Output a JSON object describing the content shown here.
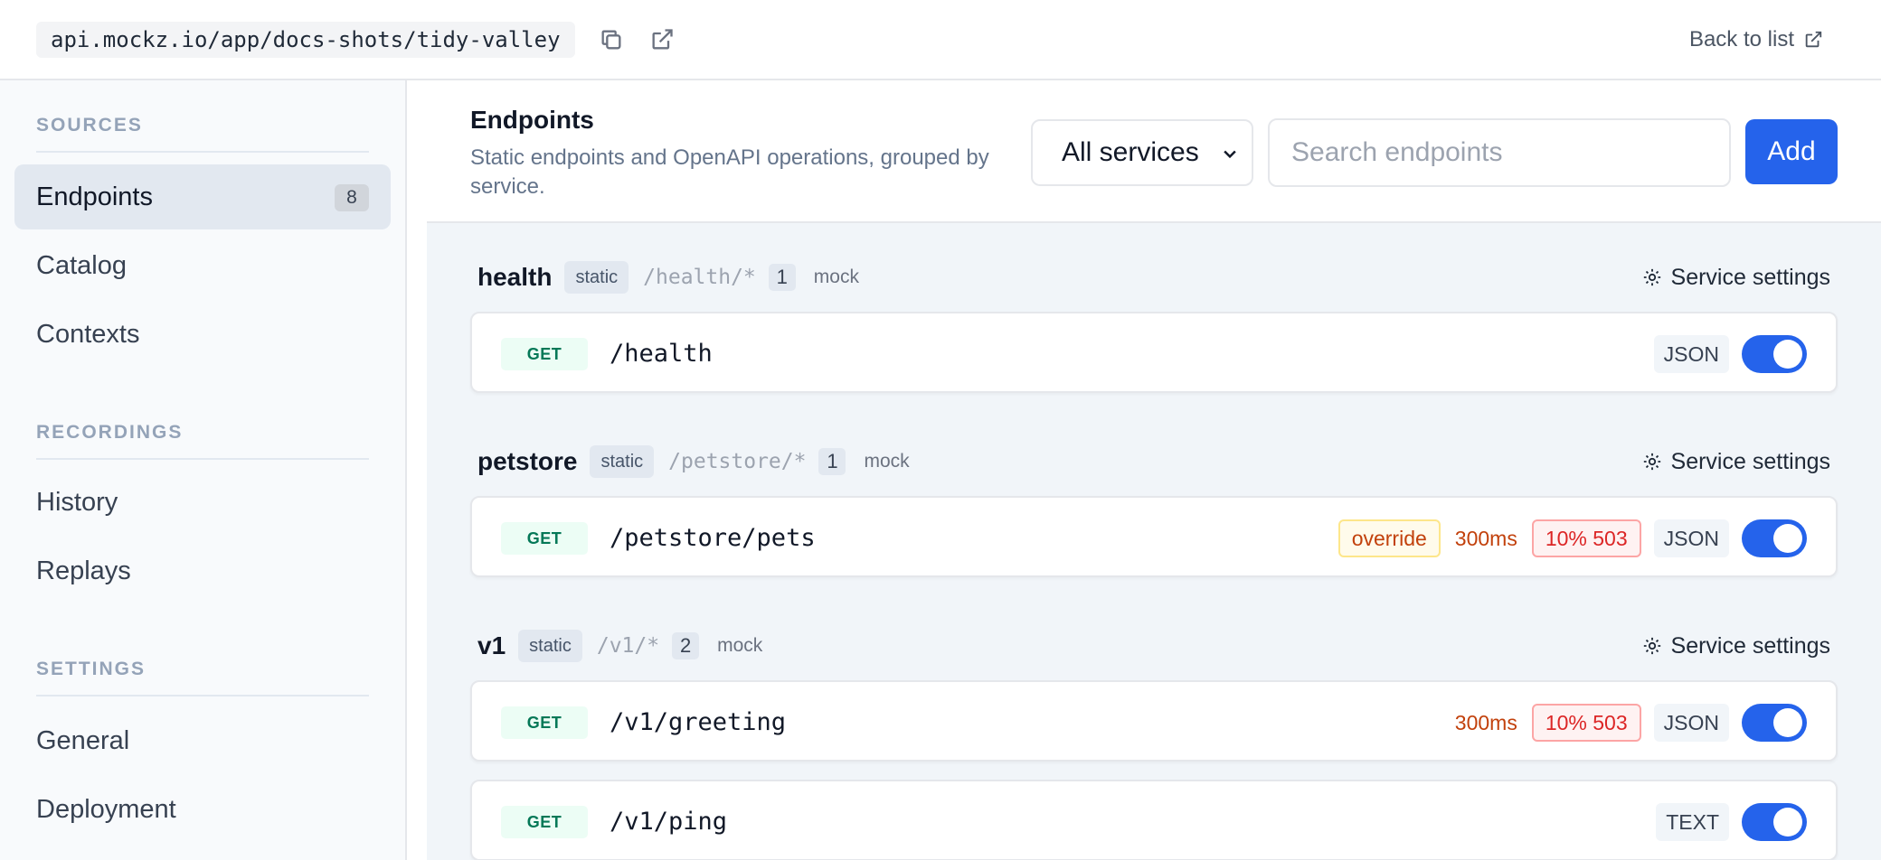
{
  "topbar": {
    "url": "api.mockz.io/app/docs-shots/tidy-valley",
    "copy_icon": "copy-icon",
    "open_icon": "external-link-icon",
    "back_label": "Back to list"
  },
  "sidebar": {
    "sections": [
      {
        "title": "SOURCES",
        "items": [
          {
            "label": "Endpoints",
            "count": "8",
            "active": true
          },
          {
            "label": "Catalog"
          },
          {
            "label": "Contexts"
          }
        ]
      },
      {
        "title": "RECORDINGS",
        "items": [
          {
            "label": "History"
          },
          {
            "label": "Replays"
          }
        ]
      },
      {
        "title": "SETTINGS",
        "items": [
          {
            "label": "General"
          },
          {
            "label": "Deployment"
          }
        ]
      }
    ]
  },
  "main": {
    "title": "Endpoints",
    "description": "Static endpoints and OpenAPI operations, grouped by service.",
    "filter_value": "All services",
    "search_placeholder": "Search endpoints",
    "add_label": "Add"
  },
  "groups": [
    {
      "name": "health",
      "badge": "static",
      "path": "/health/*",
      "count": "1",
      "mode": "mock",
      "settings_label": "Service settings",
      "endpoints": [
        {
          "method": "GET",
          "path": "/health",
          "format": "JSON",
          "enabled": true
        }
      ]
    },
    {
      "name": "petstore",
      "badge": "static",
      "path": "/petstore/*",
      "count": "1",
      "mode": "mock",
      "settings_label": "Service settings",
      "endpoints": [
        {
          "method": "GET",
          "path": "/petstore/pets",
          "override": "override",
          "latency": "300ms",
          "error": "10% 503",
          "format": "JSON",
          "enabled": true
        }
      ]
    },
    {
      "name": "v1",
      "badge": "static",
      "path": "/v1/*",
      "count": "2",
      "mode": "mock",
      "settings_label": "Service settings",
      "endpoints": [
        {
          "method": "GET",
          "path": "/v1/greeting",
          "latency": "300ms",
          "error": "10% 503",
          "format": "JSON",
          "enabled": true
        },
        {
          "method": "GET",
          "path": "/v1/ping",
          "format": "TEXT",
          "enabled": true
        }
      ]
    }
  ],
  "colors": {
    "accent": "#2563eb",
    "method_get": "#047857",
    "latency": "#c2410c",
    "error": "#dc2626"
  }
}
